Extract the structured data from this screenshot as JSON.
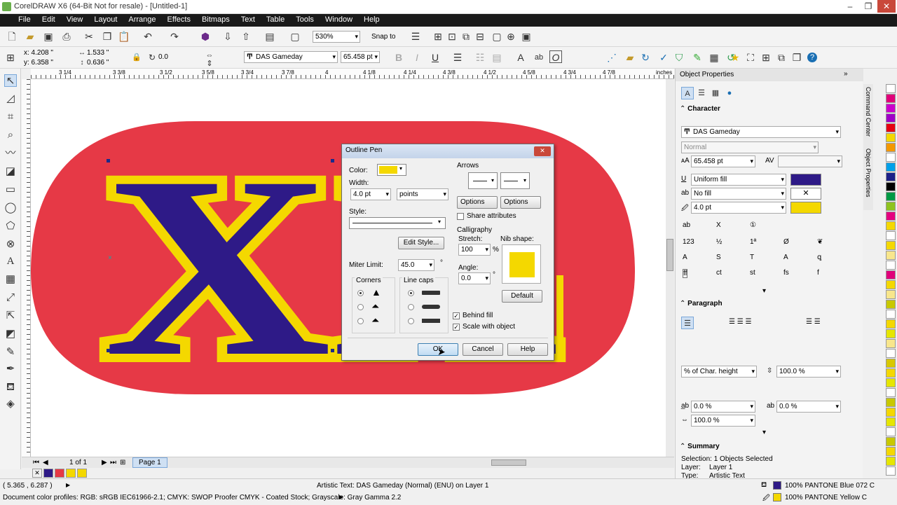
{
  "app": {
    "title": "CorelDRAW X6 (64-Bit Not for resale) - [Untitled-1]",
    "colors": {
      "menubar": "#1a1a1a",
      "ellipse": "#e63946",
      "text_fill": "#2e1a87",
      "outline": "#f4d800"
    }
  },
  "menu": [
    "File",
    "Edit",
    "View",
    "Layout",
    "Arrange",
    "Effects",
    "Bitmaps",
    "Text",
    "Table",
    "Tools",
    "Window",
    "Help"
  ],
  "standard_toolbar": {
    "zoom": "530%",
    "snap_to": "Snap to"
  },
  "property_bar": {
    "x": "x: 4.208 \"",
    "y": "y: 6.358 \"",
    "w": "1.533 \"",
    "h": "0.636 \"",
    "rotation": "0.0",
    "font": "DAS Gameday",
    "size": "65.458 pt"
  },
  "rulers": {
    "h_ticks": [
      "3 1/4",
      "3 3/8",
      "3 1/2",
      "3 5/8",
      "3 3/4",
      "3 7/8",
      "4",
      "4 1/8",
      "4 1/4",
      "4 3/8",
      "4 1/2",
      "4 5/8",
      "4 3/4",
      "4 7/8"
    ],
    "unit": "inches"
  },
  "canvas": {
    "artwork_text": "XX"
  },
  "pagebar": {
    "page_of": "1 of 1",
    "page_tab": "Page 1"
  },
  "dialog": {
    "title": "Outline Pen",
    "color_label": "Color:",
    "width_label": "Width:",
    "width_value": "4.0 pt",
    "unit_value": "points",
    "style_label": "Style:",
    "edit_style": "Edit Style...",
    "miter_label": "Miter Limit:",
    "miter_value": "45.0",
    "corners_label": "Corners",
    "linecaps_label": "Line caps",
    "arrows_label": "Arrows",
    "options1": "Options",
    "options2": "Options",
    "share_attributes": "Share attributes",
    "calligraphy_label": "Calligraphy",
    "stretch_label": "Stretch:",
    "stretch_value": "100",
    "pct": "%",
    "angle_label": "Angle:",
    "angle_value": "0.0",
    "degree": "°",
    "nib_label": "Nib shape:",
    "default_btn": "Default",
    "behind_fill": "Behind fill",
    "scale_with_object": "Scale with object",
    "ok": "OK",
    "cancel": "Cancel",
    "help": "Help"
  },
  "docker": {
    "title": "Object Properties",
    "character": "Character",
    "font": "DAS Gameday",
    "style": "Normal",
    "size": "65.458 pt",
    "fill_type": "Uniform fill",
    "bg_fill": "No fill",
    "outline_width": "4.0 pt",
    "paragraph": "Paragraph",
    "spacing_unit": "% of Char. height",
    "line_spacing": "100.0 %",
    "char_spacing": "0.0 %",
    "word_spacing": "0.0 %",
    "lang_spacing": "100.0 %",
    "summary": "Summary",
    "selection": "Selection: 1 Objects Selected",
    "layer_label": "Layer:",
    "layer_value": "Layer 1",
    "type_label": "Type:",
    "type_value": "Artistic Text"
  },
  "side_tabs": [
    "Command Center",
    "Object Properties"
  ],
  "palette": [
    "#ffffff",
    "#e0007a",
    "#cc00cc",
    "#a000c8",
    "#e60012",
    "#f4d800",
    "#f39800",
    "#ffffff",
    "#00a0e9",
    "#1d2088",
    "#000000",
    "#009944",
    "#8fc31f",
    "#e4007f",
    "#f4d800",
    "#ffffff",
    "#f4d800",
    "#f8e68c",
    "#ffffff",
    "#e0007a",
    "#f4d800",
    "#f8e68c",
    "#c8c800",
    "#ffffff",
    "#f4d800",
    "#e6e600",
    "#f8e68c",
    "#ffffff",
    "#d8c800",
    "#f4d800",
    "#e6e600",
    "#ffffff",
    "#c8c800",
    "#f4d800",
    "#e6e600",
    "#ffffff",
    "#c8c800",
    "#f4d800",
    "#e6e600",
    "#ffffff"
  ],
  "status": {
    "coords": "( 5.365 , 6.287 )",
    "object_info": "Artistic Text: DAS Gameday (Normal) (ENU) on Layer 1",
    "color_profiles": "Document color profiles: RGB: sRGB IEC61966-2.1; CMYK: SWOP Proofer CMYK - Coated Stock; Grayscale: Gray Gamma 2.2",
    "fill_info": "100% PANTONE Blue 072 C",
    "outline_info": "100% PANTONE Yellow C",
    "fill_color": "#2e1a87",
    "outline_color": "#f4d800"
  }
}
